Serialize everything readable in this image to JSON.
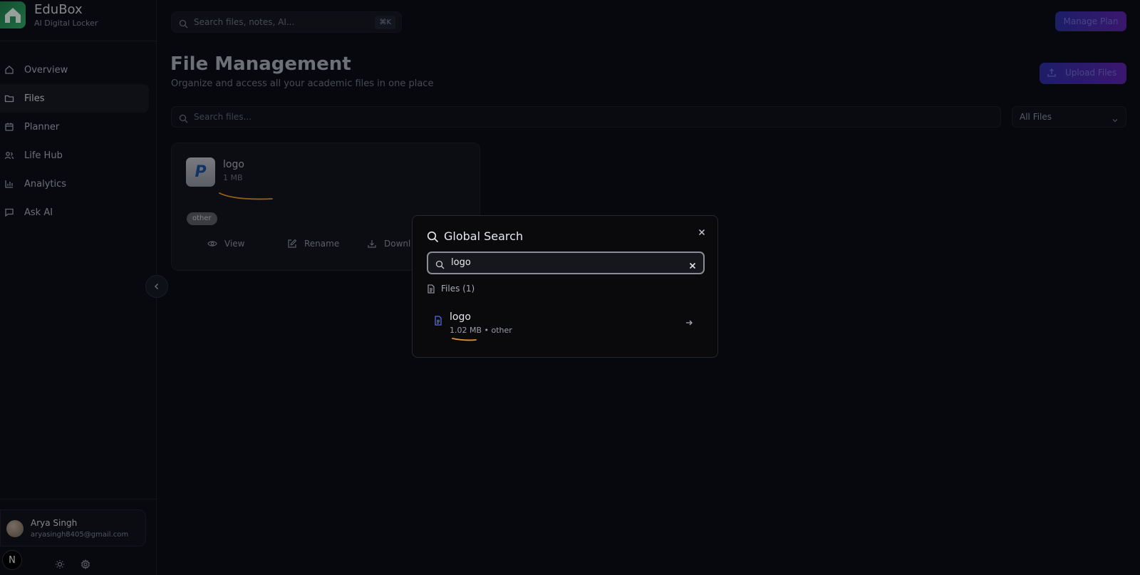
{
  "brand": {
    "name": "EduBox",
    "subtitle": "AI Digital Locker"
  },
  "sidebar": {
    "items": [
      {
        "label": "Overview",
        "icon": "home-icon"
      },
      {
        "label": "Files",
        "icon": "folder-icon",
        "active": true
      },
      {
        "label": "Planner",
        "icon": "calendar-icon"
      },
      {
        "label": "Life Hub",
        "icon": "users-icon"
      },
      {
        "label": "Analytics",
        "icon": "bar-chart-icon"
      },
      {
        "label": "Ask AI",
        "icon": "chat-icon"
      }
    ],
    "user": {
      "name": "Arya Singh",
      "email": "aryasingh8405@gmail.com"
    },
    "badge": "N"
  },
  "header": {
    "search_placeholder": "Search files, notes, AI...",
    "shortcut": "⌘K",
    "manage_plan": "Manage Plan"
  },
  "page": {
    "title": "File Management",
    "subtitle": "Organize and access all your academic files in one place",
    "upload_label": "Upload Files",
    "search_placeholder": "Search files...",
    "filter_value": "All Files"
  },
  "file_card": {
    "thumb_letter": "P",
    "name": "logo",
    "size": "1 MB",
    "tag": "other",
    "actions": {
      "view": "View",
      "rename": "Rename",
      "download": "Downl"
    }
  },
  "modal": {
    "title": "Global Search",
    "query": "logo",
    "group_label": "Files (1)",
    "result": {
      "name": "logo",
      "meta": "1.02 MB • other"
    }
  },
  "colors": {
    "accent_start": "#2d2ea0",
    "accent_end": "#5a24aa",
    "scribble": "#e8962a"
  }
}
